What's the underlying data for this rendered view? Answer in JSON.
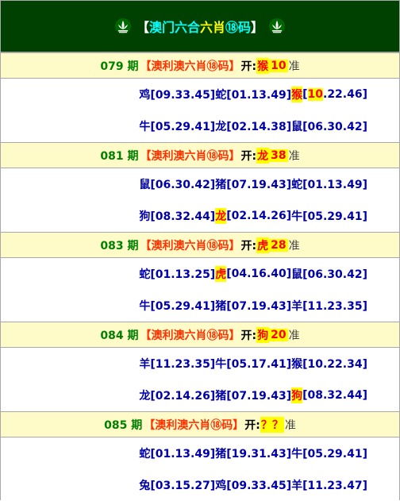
{
  "header": {
    "bracket_open": "【",
    "title_part1": "澳门六合",
    "title_part2": "六肖",
    "title_part3": "⑱码",
    "bracket_close": "】"
  },
  "sections": [
    {
      "period": "079 期",
      "label": "【澳利澳六肖⑱码】",
      "kai": "开:",
      "result_zodiac": "猴",
      "result_num": "10",
      "zhun": "准",
      "rows": [
        [
          "鸡[09.33.45]",
          "蛇[01.13.49]",
          "猴",
          "[",
          "10",
          ".22.46]"
        ],
        [
          "牛[05.29.41]",
          "龙[02.14.38]",
          "鼠[06.30.42]"
        ]
      ]
    },
    {
      "period": "081 期",
      "label": "【澳利澳六肖⑱码】",
      "kai": "开:",
      "result_zodiac": "龙",
      "result_num": "38",
      "zhun": "准",
      "rows": [
        [
          "鼠[06.30.42]",
          "猪[07.19.43]",
          "蛇[01.13.49]"
        ],
        [
          "狗[08.32.44]",
          "龙",
          "[02.14.26]",
          "牛[05.29.41]"
        ]
      ]
    },
    {
      "period": "083 期",
      "label": "【澳利澳六肖⑱码】",
      "kai": "开:",
      "result_zodiac": "虎",
      "result_num": "28",
      "zhun": "准",
      "rows": [
        [
          "蛇[01.13.25]",
          "虎",
          "[04.16.40]",
          "鼠[06.30.42]"
        ],
        [
          "牛[05.29.41]",
          "猪[07.19.43]",
          "羊[11.23.35]"
        ]
      ]
    },
    {
      "period": "084 期",
      "label": "【澳利澳六肖⑱码】",
      "kai": "开:",
      "result_zodiac": "狗",
      "result_num": "20",
      "zhun": "准",
      "rows": [
        [
          "羊[11.23.35]",
          "牛[05.17.41]",
          "猴[10.22.34]"
        ],
        [
          "龙[02.14.26]",
          "猪[07.19.43]",
          "狗",
          "[08.32.44]"
        ]
      ]
    },
    {
      "period": "085 期",
      "label": "【澳利澳六肖⑱码】",
      "kai": "开:",
      "result_zodiac": "？？",
      "result_num": "",
      "zhun": "准",
      "rows": [
        [
          "蛇[01.13.49]",
          "猪[19.31.43]",
          "牛[05.29.41]"
        ],
        [
          "兔[03.15.27]",
          "鸡[09.33.45]",
          "羊[11.23.47]"
        ]
      ]
    }
  ],
  "colors": {
    "header_bg": "#004000",
    "section_bg": "#fffbc8",
    "highlight": "#ffff00",
    "period": "#008000",
    "label": "#ff3300",
    "row_text": "#0000aa"
  }
}
